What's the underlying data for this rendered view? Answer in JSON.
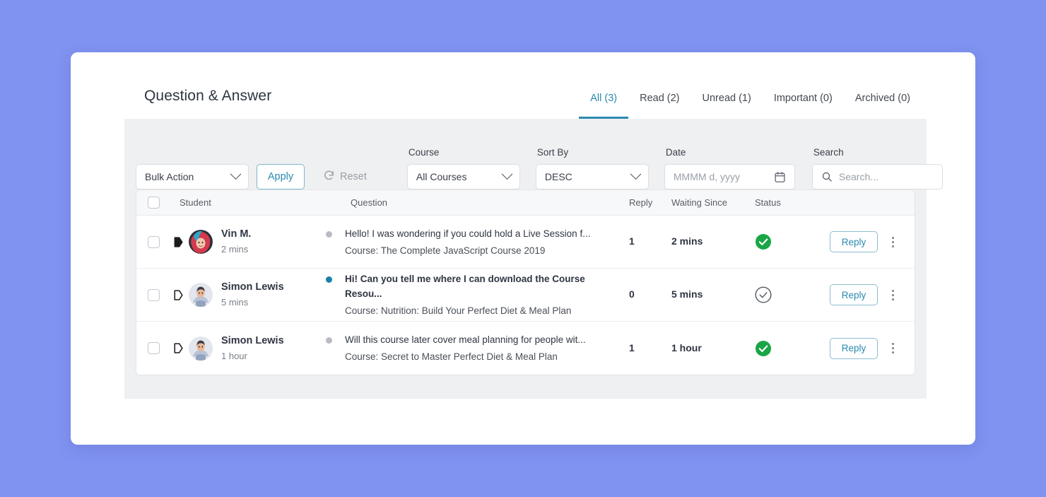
{
  "header": {
    "title": "Question & Answer",
    "tabs": [
      {
        "label": "All (3)",
        "active": true
      },
      {
        "label": "Read (2)",
        "active": false
      },
      {
        "label": "Unread (1)",
        "active": false
      },
      {
        "label": "Important (0)",
        "active": false
      },
      {
        "label": "Archived (0)",
        "active": false
      }
    ]
  },
  "filters": {
    "bulk_action": {
      "value": "Bulk Action"
    },
    "apply_label": "Apply",
    "reset_label": "Reset",
    "course": {
      "label": "Course",
      "value": "All Courses"
    },
    "sort_by": {
      "label": "Sort By",
      "value": "DESC"
    },
    "date": {
      "label": "Date",
      "value": "",
      "placeholder": "MMMM d, yyyy"
    },
    "search": {
      "label": "Search",
      "value": "",
      "placeholder": "Search..."
    }
  },
  "table": {
    "columns": {
      "student": "Student",
      "question": "Question",
      "reply": "Reply",
      "waiting_since": "Waiting Since",
      "status": "Status"
    },
    "row_action_label": "Reply",
    "rows": [
      {
        "flagged": true,
        "unread": false,
        "student_name": "Vin M.",
        "student_time": "2 mins",
        "question": "Hello! I was wondering if you could hold a Live Session f...",
        "course": "Course: The Complete JavaScript Course 2019",
        "reply": "1",
        "waiting_since": "2 mins",
        "status": "answered",
        "action": "Reply"
      },
      {
        "flagged": false,
        "unread": true,
        "student_name": "Simon Lewis",
        "student_time": "5 mins",
        "question": "Hi! Can you tell me where I can download the Course Resou...",
        "course": "Course: Nutrition: Build Your Perfect Diet & Meal Plan",
        "reply": "0",
        "waiting_since": "5 mins",
        "status": "unanswered",
        "action": "Reply"
      },
      {
        "flagged": false,
        "unread": false,
        "student_name": "Simon Lewis",
        "student_time": "1 hour",
        "question": "Will this course later cover meal planning for people wit...",
        "course": "Course: Secret to Master Perfect Diet & Meal Plan",
        "reply": "1",
        "waiting_since": "1 hour",
        "status": "answered",
        "action": "Reply"
      }
    ]
  },
  "colors": {
    "page_background": "#8093f1",
    "accent": "#2b8ab1",
    "status_answered": "#1aa546",
    "status_unanswered": "#5b6069",
    "unread_dot": "#1880a8",
    "read_dot": "#b8bcc2",
    "filter_panel": "#eff0f2"
  },
  "icons": {
    "chevron_down": "chevron-down-icon",
    "calendar": "calendar-icon",
    "search": "search-icon",
    "reset": "refresh-icon",
    "flag": "flag-icon",
    "kebab": "more-vertical-icon",
    "check_circle": "check-circle-icon"
  }
}
